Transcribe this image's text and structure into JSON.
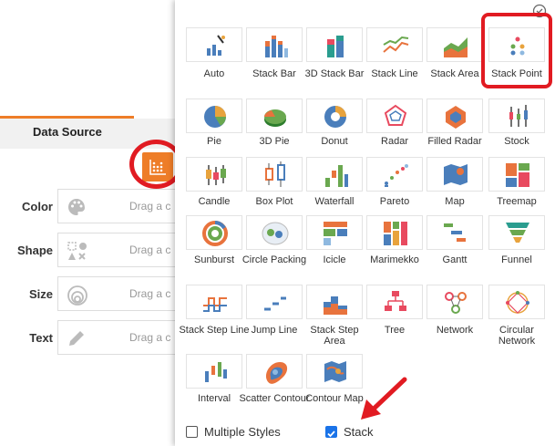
{
  "left_panel": {
    "tab_label": "Data Source",
    "fields": [
      {
        "label": "Color",
        "hint": "Drag a c",
        "icon": "palette-icon"
      },
      {
        "label": "Shape",
        "hint": "Drag a c",
        "icon": "shapes-icon"
      },
      {
        "label": "Size",
        "hint": "Drag a c",
        "icon": "size-icon"
      },
      {
        "label": "Text",
        "hint": "Drag a c",
        "icon": "pencil-icon"
      }
    ]
  },
  "chart_types": [
    {
      "label": "Auto",
      "icon": "auto-chart-icon"
    },
    {
      "label": "Stack Bar",
      "icon": "stack-bar-icon"
    },
    {
      "label": "3D Stack Bar",
      "icon": "3d-stack-bar-icon"
    },
    {
      "label": "Stack Line",
      "icon": "stack-line-icon"
    },
    {
      "label": "Stack Area",
      "icon": "stack-area-icon"
    },
    {
      "label": "Stack Point",
      "icon": "stack-point-icon",
      "selected": true
    },
    {
      "label": "Pie",
      "icon": "pie-icon"
    },
    {
      "label": "3D Pie",
      "icon": "3d-pie-icon"
    },
    {
      "label": "Donut",
      "icon": "donut-icon"
    },
    {
      "label": "Radar",
      "icon": "radar-icon"
    },
    {
      "label": "Filled Radar",
      "icon": "filled-radar-icon"
    },
    {
      "label": "Stock",
      "icon": "stock-icon"
    },
    {
      "label": "Candle",
      "icon": "candle-icon"
    },
    {
      "label": "Box Plot",
      "icon": "box-plot-icon"
    },
    {
      "label": "Waterfall",
      "icon": "waterfall-icon"
    },
    {
      "label": "Pareto",
      "icon": "pareto-icon"
    },
    {
      "label": "Map",
      "icon": "map-icon"
    },
    {
      "label": "Treemap",
      "icon": "treemap-icon"
    },
    {
      "label": "Sunburst",
      "icon": "sunburst-icon"
    },
    {
      "label": "Circle Packing",
      "icon": "circle-packing-icon"
    },
    {
      "label": "Icicle",
      "icon": "icicle-icon"
    },
    {
      "label": "Marimekko",
      "icon": "marimekko-icon"
    },
    {
      "label": "Gantt",
      "icon": "gantt-icon"
    },
    {
      "label": "Funnel",
      "icon": "funnel-icon"
    },
    {
      "label": "Stack Step Line",
      "icon": "stack-step-line-icon"
    },
    {
      "label": "Jump Line",
      "icon": "jump-line-icon"
    },
    {
      "label": "Stack Step Area",
      "icon": "stack-step-area-icon"
    },
    {
      "label": "Tree",
      "icon": "tree-icon"
    },
    {
      "label": "Network",
      "icon": "network-icon"
    },
    {
      "label": "Circular Network",
      "icon": "circular-network-icon"
    },
    {
      "label": "Interval",
      "icon": "interval-icon"
    },
    {
      "label": "Scatter Contour",
      "icon": "scatter-contour-icon"
    },
    {
      "label": "Contour Map",
      "icon": "contour-map-icon"
    }
  ],
  "options": {
    "multiple_styles": {
      "label": "Multiple Styles",
      "checked": false
    },
    "stack": {
      "label": "Stack",
      "checked": true
    }
  },
  "colors": {
    "accent": "#ee7d28",
    "highlight": "#e11b22",
    "checkbox": "#1a73e8"
  }
}
